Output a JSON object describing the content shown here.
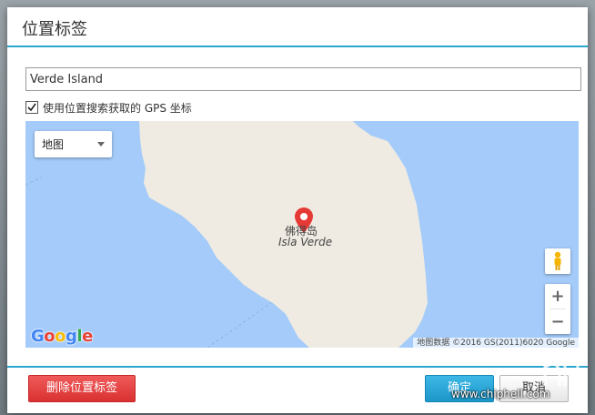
{
  "dialog": {
    "title": "位置标签"
  },
  "location": {
    "value": "Verde Island"
  },
  "gps": {
    "checked": true,
    "label": "使用位置搜索获取的 GPS 坐标"
  },
  "map": {
    "type_selector": "地图",
    "place_name_cn": "佛得岛",
    "place_name_en": "Isla Verde",
    "zoom_in": "+",
    "zoom_out": "−",
    "attribution": "地图数据 ©2016 GS(2011)6020 Google",
    "logo_text": "Google",
    "pin_color": "#e53935",
    "water_color": "#a4cbf9",
    "land_color": "#efebe2",
    "icons": [
      "pegman-icon",
      "map-pin-icon",
      "google-logo"
    ]
  },
  "footer": {
    "delete_label": "删除位置标签",
    "ok_label": "确定",
    "cancel_label": "取消",
    "watermark": "www.chiphell.com",
    "delete_color": "#e23b3b",
    "ok_color": "#29a9da"
  }
}
